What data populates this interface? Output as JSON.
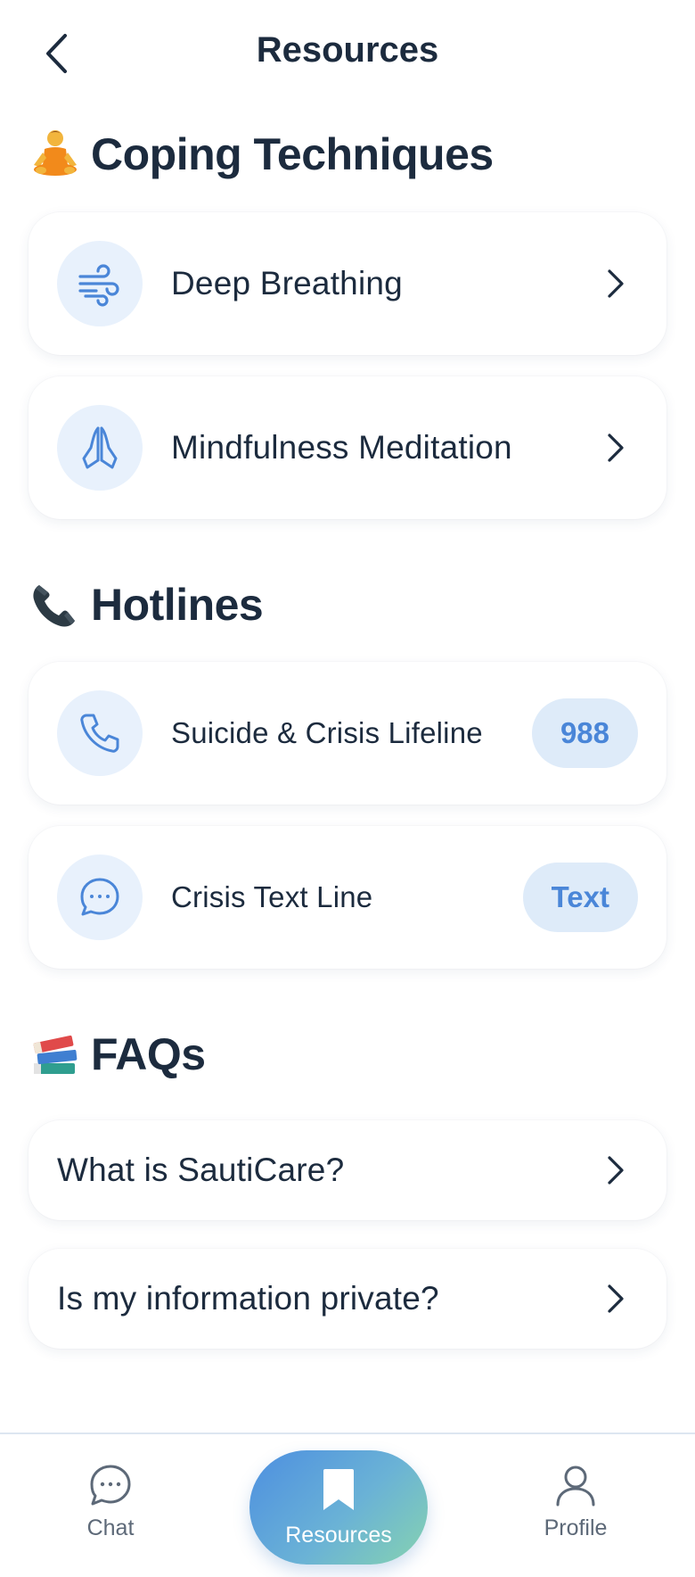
{
  "header": {
    "title": "Resources",
    "back_icon": "chevron-left-icon"
  },
  "sections": {
    "coping": {
      "emoji_icon": "meditating-person-icon",
      "title": "Coping Techniques",
      "items": [
        {
          "label": "Deep Breathing",
          "icon": "wind-icon"
        },
        {
          "label": "Mindfulness Meditation",
          "icon": "praying-hands-icon"
        }
      ]
    },
    "hotlines": {
      "emoji_icon": "telephone-receiver-icon",
      "title": "Hotlines",
      "items": [
        {
          "label": "Suicide & Crisis Lifeline",
          "icon": "phone-icon",
          "action": "988"
        },
        {
          "label": "Crisis Text Line",
          "icon": "message-dots-icon",
          "action": "Text"
        }
      ]
    },
    "faqs": {
      "emoji_icon": "books-icon",
      "title": "FAQs",
      "items": [
        {
          "label": "What is SautiCare?"
        },
        {
          "label": "Is my information private?"
        }
      ]
    }
  },
  "bottom_nav": {
    "items": [
      {
        "label": "Chat",
        "icon": "chat-bubble-icon",
        "active": false
      },
      {
        "label": "Resources",
        "icon": "bookmark-icon",
        "active": true
      },
      {
        "label": "Profile",
        "icon": "user-icon",
        "active": false
      }
    ]
  },
  "colors": {
    "text_primary": "#1c2b3e",
    "icon_accent": "#4a86d8",
    "icon_bg": "#e8f1fc",
    "pill_bg": "#deebf9",
    "nav_gradient_start": "#4d8fe0",
    "nav_gradient_end": "#86d3b0",
    "nav_inactive": "#5d6978"
  }
}
